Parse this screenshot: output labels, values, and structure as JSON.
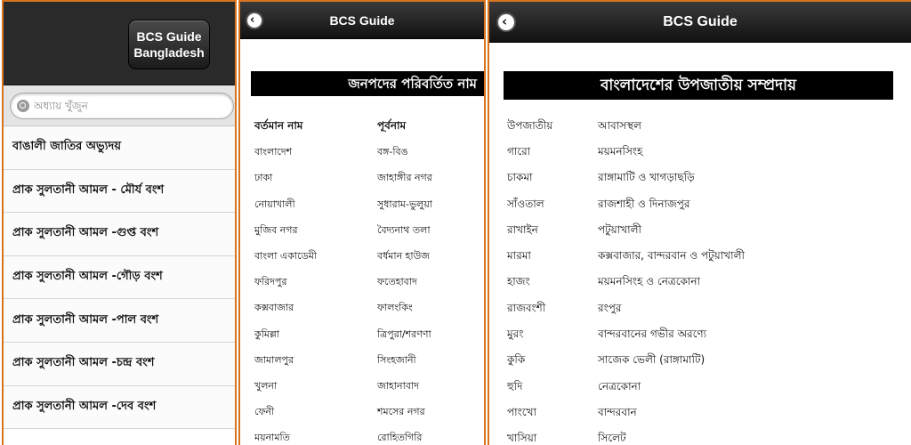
{
  "panel1": {
    "logo": {
      "line1": "BCS Guide",
      "line2": "Bangladesh"
    },
    "search": {
      "placeholder": "অধ্যায় খুঁজুন"
    },
    "items": [
      "বাঙালী জাতির অভ্যুদয়",
      "প্রাক সুলতানী আমল - মৌর্য বংশ",
      "প্রাক সুলতানী আমল -গুপ্ত বংশ",
      "প্রাক সুলতানী আমল -গৌড় বংশ",
      "প্রাক সুলতানী আমল -পাল বংশ",
      "প্রাক সুলতানী আমল -চন্দ্র বংশ",
      "প্রাক সুলতানী আমল -দেব বংশ"
    ]
  },
  "panel2": {
    "title": "BCS Guide",
    "banner": "জনপদের পরিবর্তিত নাম",
    "headers": {
      "current": "বর্তমান নাম",
      "former": "পূর্বনাম"
    },
    "rows": [
      {
        "current": "বাংলাদেশ",
        "former": "বঙ্গ-বিঙ"
      },
      {
        "current": "ঢাকা",
        "former": "জাহাঙ্গীর নগর"
      },
      {
        "current": "নোয়াখালী",
        "former": "সুধারাম-ভুলুয়া"
      },
      {
        "current": "মুজিব নগর",
        "former": "বৈদ্যনাথ তলা"
      },
      {
        "current": "বাংলা একাডেমী",
        "former": "বর্ধমান হাউজ"
      },
      {
        "current": "ফরিদপুর",
        "former": "ফতেহাবাদ"
      },
      {
        "current": "কক্সবাজার",
        "former": "ফালংকিং"
      },
      {
        "current": "কুমিল্লা",
        "former": "ত্রিপুরা/শরণণা"
      },
      {
        "current": "জামালপুর",
        "former": "সিংহজানী"
      },
      {
        "current": "খুলনা",
        "former": "জাহানাবাদ"
      },
      {
        "current": "ফেনী",
        "former": "শমসের নগর"
      },
      {
        "current": "ময়নামতি",
        "former": "রোহিতগিরি"
      }
    ]
  },
  "panel3": {
    "title": "BCS Guide",
    "banner": "বাংলাদেশের উপজাতীয় সম্প্রদায়",
    "rows": [
      {
        "tribe": "উপজাতীয়",
        "place": "আবাসস্থল"
      },
      {
        "tribe": "গারো",
        "place": "ময়মনসিংহ"
      },
      {
        "tribe": "চাকমা",
        "place": "রাঙ্গামাটি ও খাগড়াছড়ি"
      },
      {
        "tribe": "সাঁওতাল",
        "place": "রাজশাহী ও দিনাজপুর"
      },
      {
        "tribe": "রাখাইন",
        "place": "পটুয়াখালী"
      },
      {
        "tribe": "মারমা",
        "place": "কক্সবাজার, বান্দরবান ও পটুয়াখালী"
      },
      {
        "tribe": "হাজং",
        "place": "ময়মনসিংহ ও নেত্রকোনা"
      },
      {
        "tribe": "রাজবংশী",
        "place": "রংপুর"
      },
      {
        "tribe": "মুরং",
        "place": "বান্দরবানের গভীর অরণ্যে"
      },
      {
        "tribe": "কুকি",
        "place": "সাজেক ভেলী (রাঙ্গামাটি)"
      },
      {
        "tribe": "হুদি",
        "place": "নেত্রকোনা"
      },
      {
        "tribe": "পাংখো",
        "place": "বান্দরবান"
      },
      {
        "tribe": "খাসিয়া",
        "place": "সিলেট"
      }
    ]
  },
  "colors": {
    "frame": "#d8741f",
    "header": "#1e1e1e",
    "banner": "#000000"
  }
}
